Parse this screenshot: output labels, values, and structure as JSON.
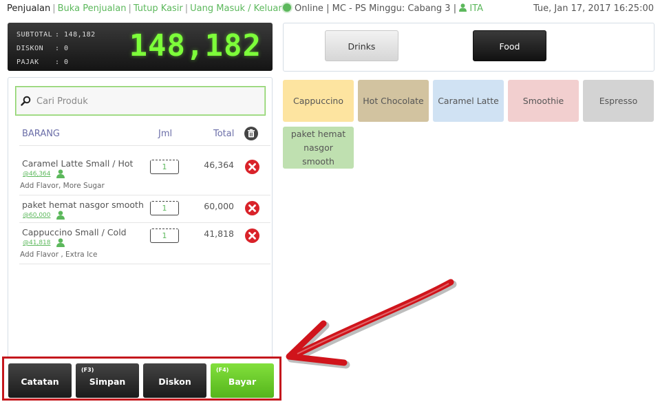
{
  "nav": {
    "active": "Penjualan",
    "links": [
      "Buka Penjualan",
      "Tutup Kasir",
      "Uang Masuk / Keluar"
    ]
  },
  "status": {
    "online": "Online",
    "sep": "|",
    "location": "MC - PS Minggu: Cabang 3",
    "user": "ITA"
  },
  "datetime": "Tue, Jan 17, 2017 16:25:00",
  "display": {
    "subtotal_label": "SUBTOTAL",
    "subtotal_value": ": 148,182",
    "diskon_label": "DISKON",
    "diskon_value": ": 0",
    "pajak_label": "PAJAK",
    "pajak_value": ": 0",
    "total": "148,182",
    "total_color": "#7dff3a"
  },
  "search": {
    "placeholder": "Cari Produk",
    "icon": "search-icon"
  },
  "table": {
    "headers": {
      "item": "BARANG",
      "qty": "Jml",
      "total": "Total"
    },
    "items": [
      {
        "name": "Caramel Latte Small / Hot",
        "unit_price": "@46,364",
        "notes": "Add Flavor, More Sugar",
        "qty": "1",
        "total": "46,364"
      },
      {
        "name": "paket hemat nasgor smooth",
        "unit_price": "@60,000",
        "notes": "",
        "qty": "1",
        "total": "60,000"
      },
      {
        "name": "Cappuccino Small / Cold",
        "unit_price": "@41,818",
        "notes": "Add Flavor , Extra Ice",
        "qty": "1",
        "total": "41,818"
      }
    ]
  },
  "actions": {
    "catatan": {
      "label": "Catatan",
      "key": ""
    },
    "simpan": {
      "label": "Simpan",
      "key": "(F3)"
    },
    "diskon": {
      "label": "Diskon",
      "key": ""
    },
    "bayar": {
      "label": "Bayar",
      "key": "(F4)"
    }
  },
  "categories": {
    "drinks": "Drinks",
    "food": "Food"
  },
  "products": [
    {
      "label": "Cappuccino",
      "color": "#fde4a0"
    },
    {
      "label": "Hot Chocolate",
      "color": "#d2c3a0"
    },
    {
      "label": "Caramel Latte",
      "color": "#d0e2f3"
    },
    {
      "label": "Smoothie",
      "color": "#f2cfcf"
    },
    {
      "label": "Espresso",
      "color": "#d3d3d3"
    },
    {
      "label": "paket hemat nasgor smooth",
      "color": "#bfe0b0"
    }
  ],
  "colors": {
    "accent_green": "#5cb85c",
    "highlight_red": "#c4161c"
  }
}
